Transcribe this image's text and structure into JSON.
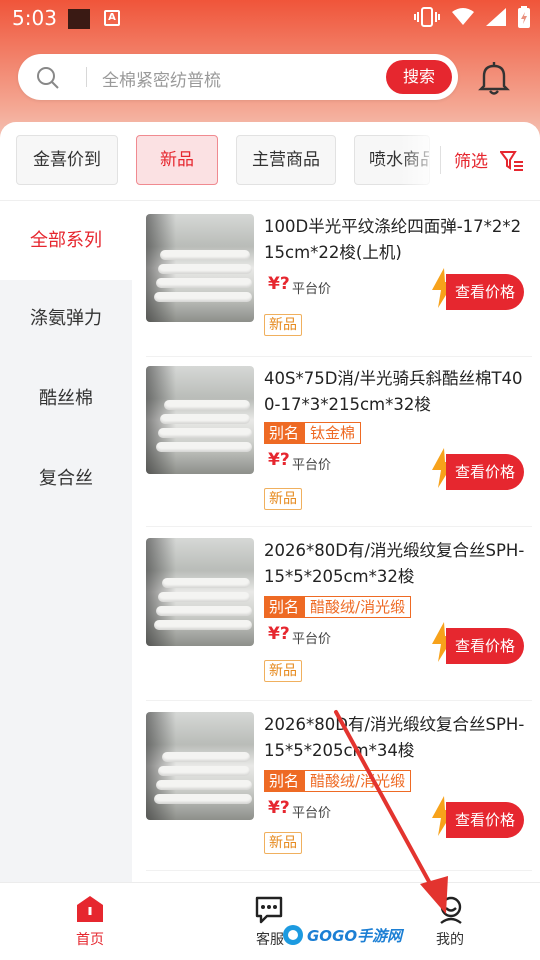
{
  "status_bar": {
    "time": "5:03",
    "app_badge": "A"
  },
  "search": {
    "placeholder": "全棉紧密纺普梳",
    "button_label": "搜索"
  },
  "filters": {
    "tabs": [
      {
        "label": "金喜价到"
      },
      {
        "label": "新品"
      },
      {
        "label": "主营商品"
      },
      {
        "label": "喷水商品"
      }
    ],
    "active_tab": "新品",
    "filter_label": "筛选"
  },
  "categories": {
    "items": [
      {
        "label": "全部系列"
      },
      {
        "label": "涤氨弹力"
      },
      {
        "label": "酷丝棉"
      },
      {
        "label": "复合丝"
      }
    ],
    "active": "全部系列"
  },
  "products": [
    {
      "title": "100D半光平纹涤纶四面弹-17*2*215cm*22梭(上机)",
      "alias_key": "",
      "alias_value": "",
      "price_symbol": "¥?",
      "price_label": "平台价",
      "button_label": "查看价格",
      "badge": "新品"
    },
    {
      "title": "40S*75D消/半光骑兵斜酷丝棉T400-17*3*215cm*32梭",
      "alias_key": "别名",
      "alias_value": "钛金棉",
      "price_symbol": "¥?",
      "price_label": "平台价",
      "button_label": "查看价格",
      "badge": "新品"
    },
    {
      "title": "2026*80D有/消光缎纹复合丝SPH-15*5*205cm*32梭",
      "alias_key": "别名",
      "alias_value": "醋酸绒/消光缎",
      "price_symbol": "¥?",
      "price_label": "平台价",
      "button_label": "查看价格",
      "badge": "新品"
    },
    {
      "title": "2026*80D有/消光缎纹复合丝SPH-15*5*205cm*34梭",
      "alias_key": "别名",
      "alias_value": "醋酸绒/消光缎",
      "price_symbol": "¥?",
      "price_label": "平台价",
      "button_label": "查看价格",
      "badge": "新品"
    }
  ],
  "bottom_nav": {
    "items": [
      {
        "label": "首页",
        "icon": "home-icon"
      },
      {
        "label": "客服",
        "icon": "chat-icon"
      },
      {
        "label": "我的",
        "icon": "profile-icon"
      }
    ],
    "active": "首页"
  },
  "watermark": {
    "text": "GOGO手游网"
  },
  "colors": {
    "accent": "#e6272f",
    "alias": "#ee6a24",
    "badge": "#e68a1e"
  }
}
